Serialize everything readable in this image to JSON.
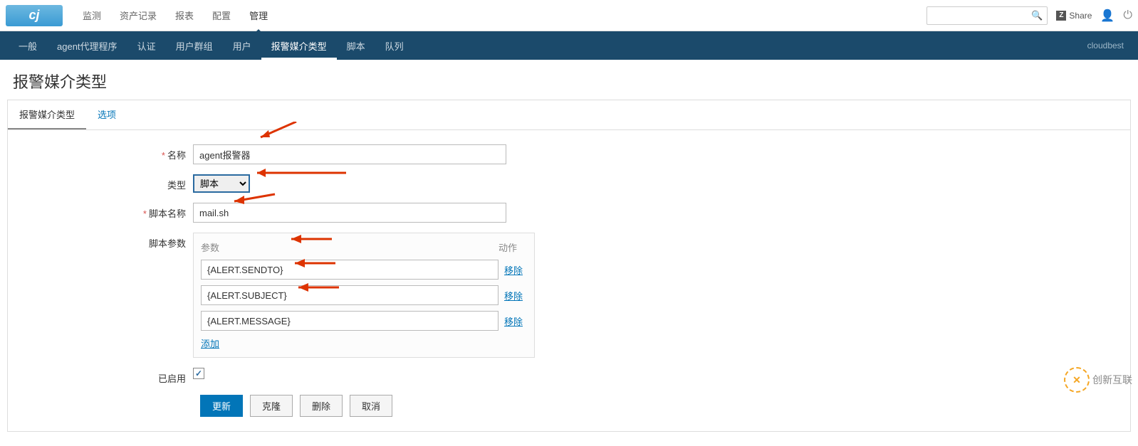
{
  "logo_text": "cj",
  "top_nav": [
    "监测",
    "资产记录",
    "报表",
    "配置",
    "管理"
  ],
  "top_nav_active": 4,
  "share_label": "Share",
  "sub_nav": [
    "一般",
    "agent代理程序",
    "认证",
    "用户群组",
    "用户",
    "报警媒介类型",
    "脚本",
    "队列"
  ],
  "sub_nav_active": 5,
  "sub_right": "cloudbest",
  "page_title": "报警媒介类型",
  "tabs": [
    "报警媒介类型",
    "选项"
  ],
  "tab_active": 0,
  "form": {
    "name_label": "名称",
    "name_value": "agent报警器",
    "type_label": "类型",
    "type_value": "脚本",
    "script_name_label": "脚本名称",
    "script_name_value": "mail.sh",
    "params_label": "脚本参数",
    "params_header_param": "参数",
    "params_header_action": "动作",
    "params": [
      {
        "value": "{ALERT.SENDTO}",
        "remove": "移除"
      },
      {
        "value": "{ALERT.SUBJECT}",
        "remove": "移除"
      },
      {
        "value": "{ALERT.MESSAGE}",
        "remove": "移除"
      }
    ],
    "add_label": "添加",
    "enabled_label": "已启用",
    "enabled": true
  },
  "buttons": {
    "update": "更新",
    "clone": "克隆",
    "delete": "删除",
    "cancel": "取消"
  },
  "brand_corner": "创新互联"
}
